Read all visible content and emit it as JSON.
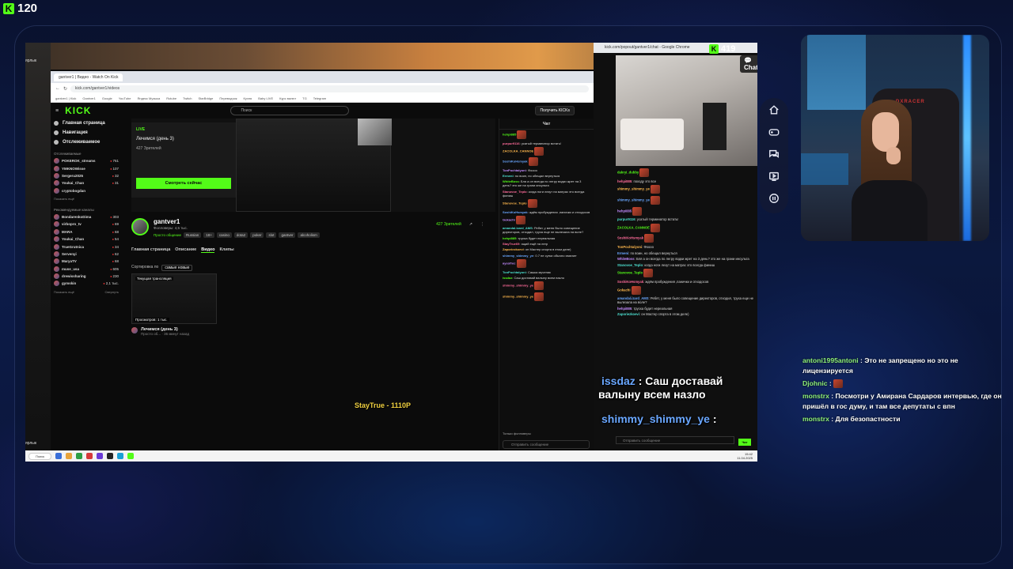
{
  "overlay": {
    "viewer_count": "120",
    "popout_viewers": "419",
    "chat_button": "Chat",
    "game_tag": "StayTrue - 1110P"
  },
  "colors": {
    "kick_green": "#53fc18",
    "feed_username": "#8ef07a",
    "big_username": "#6aa7ff"
  },
  "browser": {
    "tab_title": "gantver1 | Видео - Watch On Kick",
    "url": "kick.com/gantver1/videos",
    "bookmarks": [
      "gantver1 | Kick",
      "Gantver1",
      "Google",
      "YouTube",
      "Яндекс Музыка",
      "Rutube",
      "Twitch",
      "StarBridge",
      "Переводчик",
      "Кухня",
      "Baby LIVE",
      "Курс валют",
      "TG",
      "Telegram"
    ]
  },
  "kick": {
    "logo": "KICK",
    "search_placeholder": "Поиск",
    "get_kicks": "Получить KICKs",
    "nav": [
      "Главная страница",
      "Навигация",
      "Отслеживаемое"
    ],
    "followed_title": "Отслеживаемые",
    "followed": [
      {
        "name": "POKEROK_streams",
        "count": "761"
      },
      {
        "name": "YMKNOWisse",
        "count": "107"
      },
      {
        "name": "Sergeru2025",
        "count": "32"
      },
      {
        "name": "Youkai_Chan",
        "count": "31"
      },
      {
        "name": "cryptobogdan",
        "count": ""
      }
    ],
    "show_more": "Показать ещё",
    "collapse": "Свернуть",
    "recommended_title": "Рекомендуемые каналы",
    "recommended": [
      {
        "name": "BondarenkoDima",
        "count": "303"
      },
      {
        "name": "virbopro_tv",
        "count": "69"
      },
      {
        "name": "MARA",
        "count": "68"
      },
      {
        "name": "Youkai_Chan",
        "count": "54"
      },
      {
        "name": "TrueGrutnica",
        "count": "34"
      },
      {
        "name": "Servenyi",
        "count": "62"
      },
      {
        "name": "MaryaTV",
        "count": "68"
      },
      {
        "name": "muse_usa",
        "count": "605"
      },
      {
        "name": "drewissharing",
        "count": "230"
      },
      {
        "name": "gymskin",
        "count": "2,1 тыс."
      }
    ],
    "player": {
      "live": "LIVE",
      "title": "Лечимся (день 3)",
      "viewers": "427 Зрителей",
      "watch_now": "Смотреть сейчас"
    },
    "channel": {
      "name": "gantver1",
      "followers": "Фолловеры: 4,5 тыс.",
      "category": "Просто общение",
      "tags": [
        "Russian",
        "18+",
        "casino",
        "dota2",
        "poker",
        "slot",
        "gantver",
        "alcoholism"
      ],
      "viewers": "427 Зрителей"
    },
    "tabs": [
      "Главная страница",
      "Описание",
      "Видео",
      "Клипы"
    ],
    "sort_label": "Сортировка по",
    "sort_value": "самые новые",
    "video": {
      "label": "Текущая трансляция",
      "views": "Просмотров: 1 тыс.",
      "title": "Лечимся (день 3)",
      "sub": "Просто об... · 36 минут назад"
    },
    "chat_title": "Чат",
    "chat_messages": [
      {
        "user": "hehpi885",
        "text": ""
      },
      {
        "user": "purpur9116",
        "text": "усатый терминатор встать!"
      },
      {
        "user": "ZACOLKA_CANNOE",
        "text": ""
      },
      {
        "user": "SoshiKoHsmyak",
        "text": ""
      },
      {
        "user": "TonPochtalyoni",
        "text": "Фоооо"
      },
      {
        "user": "Ermeni",
        "text": "по воин, но обещал вернуться"
      },
      {
        "user": "WhiteBoss",
        "text": "Бля а он всегда по легру водки жрет на 3 день? это же на грани инсульта"
      },
      {
        "user": "Stanovoe_Teplo",
        "text": "когда ноги лезут на матрас это всегда финиш"
      },
      {
        "user": "Stanovoe_Teplo",
        "text": ""
      },
      {
        "user": "SoshiKoHsmyak",
        "text": "ждём пробуждения ,панички и отходосов"
      },
      {
        "user": "Gokachi",
        "text": ""
      },
      {
        "user": "amandal.izard_AMS",
        "text": "Ребят, у меня было совещение директоров, отходил, труха еще не вылезала на воле?"
      },
      {
        "user": "hehpi885",
        "text": "труска будет нереальная"
      },
      {
        "user": "StayTrue69",
        "text": "ящий ещё на легр"
      },
      {
        "user": "Zaporiezkoevi",
        "text": "он Мастер спорта в этом деле)"
      },
      {
        "user": "shimmy_shimmy_ye",
        "text": "0.7 не сутки обычно хватает"
      },
      {
        "user": "ayeofrec",
        "text": ""
      },
      {
        "user": "TonPochtalyoni",
        "text": "Сашка мученик"
      },
      {
        "user": "issdaz",
        "text": "Саш доставай валыну всем назло"
      },
      {
        "user": "shimmy_shimmy_ye",
        "text": ""
      },
      {
        "user": "shimmy_shimmy_ye",
        "text": ""
      }
    ],
    "only_followers": "Только фолловеры",
    "send_placeholder": "Отправить сообщение",
    "send_button": "Чат"
  },
  "popout": {
    "window_title": "kick.com/popout/gantver1/chat - Google Chrome",
    "messages": [
      {
        "user": "dakryi_dubby",
        "text": ""
      },
      {
        "user": "hehpi885",
        "text": "походу это все"
      },
      {
        "user": "shimmy_shimmy_ye",
        "text": ""
      },
      {
        "user": "shimmy_shimmy_ye",
        "text": ""
      },
      {
        "user": "hehpi885",
        "text": ""
      },
      {
        "user": "purpur9116",
        "text": "усатый терминатор встать!"
      },
      {
        "user": "ZACOLKA_CANNOE",
        "text": ""
      },
      {
        "user": "SoshiKoHsmyak",
        "text": ""
      },
      {
        "user": "TonPochtalyoni",
        "text": "Фоооо"
      },
      {
        "user": "Ermeni",
        "text": "по воин, но обещал вернуться"
      },
      {
        "user": "WhiteBoss",
        "text": "Бля а он всегда по легру водки жрет на 3 день? это же на грани инсульта"
      },
      {
        "user": "Stanovoe_Teplo",
        "text": "когда ноги лезут на матрас это всегда финиш"
      },
      {
        "user": "Stanovoe_Teplo",
        "text": ""
      },
      {
        "user": "SoshiKoHsmyak",
        "text": "ждём пробуждения ,панички и отходосов"
      },
      {
        "user": "Gokachi",
        "text": ""
      },
      {
        "user": "amandal.izard_AMS",
        "text": "Ребят, у меня было совещение директоров, отходил, труха еще не вылезала на воле?"
      },
      {
        "user": "hehpi885",
        "text": "труска будет нереальная"
      },
      {
        "user": "Zaporiezkoevi",
        "text": "он Мастер спорта в этом деле)"
      }
    ],
    "big_line1_user": "issdaz",
    "big_line1_text": ": Саш доставай",
    "big_line2": "валыну всем назло",
    "big_line3_user": "shimmy_shimmy_ye",
    "big_line3_text": ":",
    "send_placeholder": "Отправить сообщение",
    "send_button": "Чат"
  },
  "taskbar": {
    "search": "Поиск",
    "time": "15:42",
    "date": "11.04.2025"
  },
  "sidenav": [
    "home-icon",
    "gamepad-icon",
    "chat-icon",
    "video-icon",
    "pause-icon"
  ],
  "feed": [
    {
      "user": "antoni1995antoni",
      "text": "Это не запрещено но это не лицензируется",
      "emote": false
    },
    {
      "user": "Djohnic",
      "text": "",
      "emote": true
    },
    {
      "user": "monstrx",
      "text": "Посмотри у Амирана Сардаров интервью, где он пришёл в гос думу, и там все депутаты с впн",
      "emote": false
    },
    {
      "user": "monstrx",
      "text": "Для безопастности",
      "emote": false
    }
  ]
}
